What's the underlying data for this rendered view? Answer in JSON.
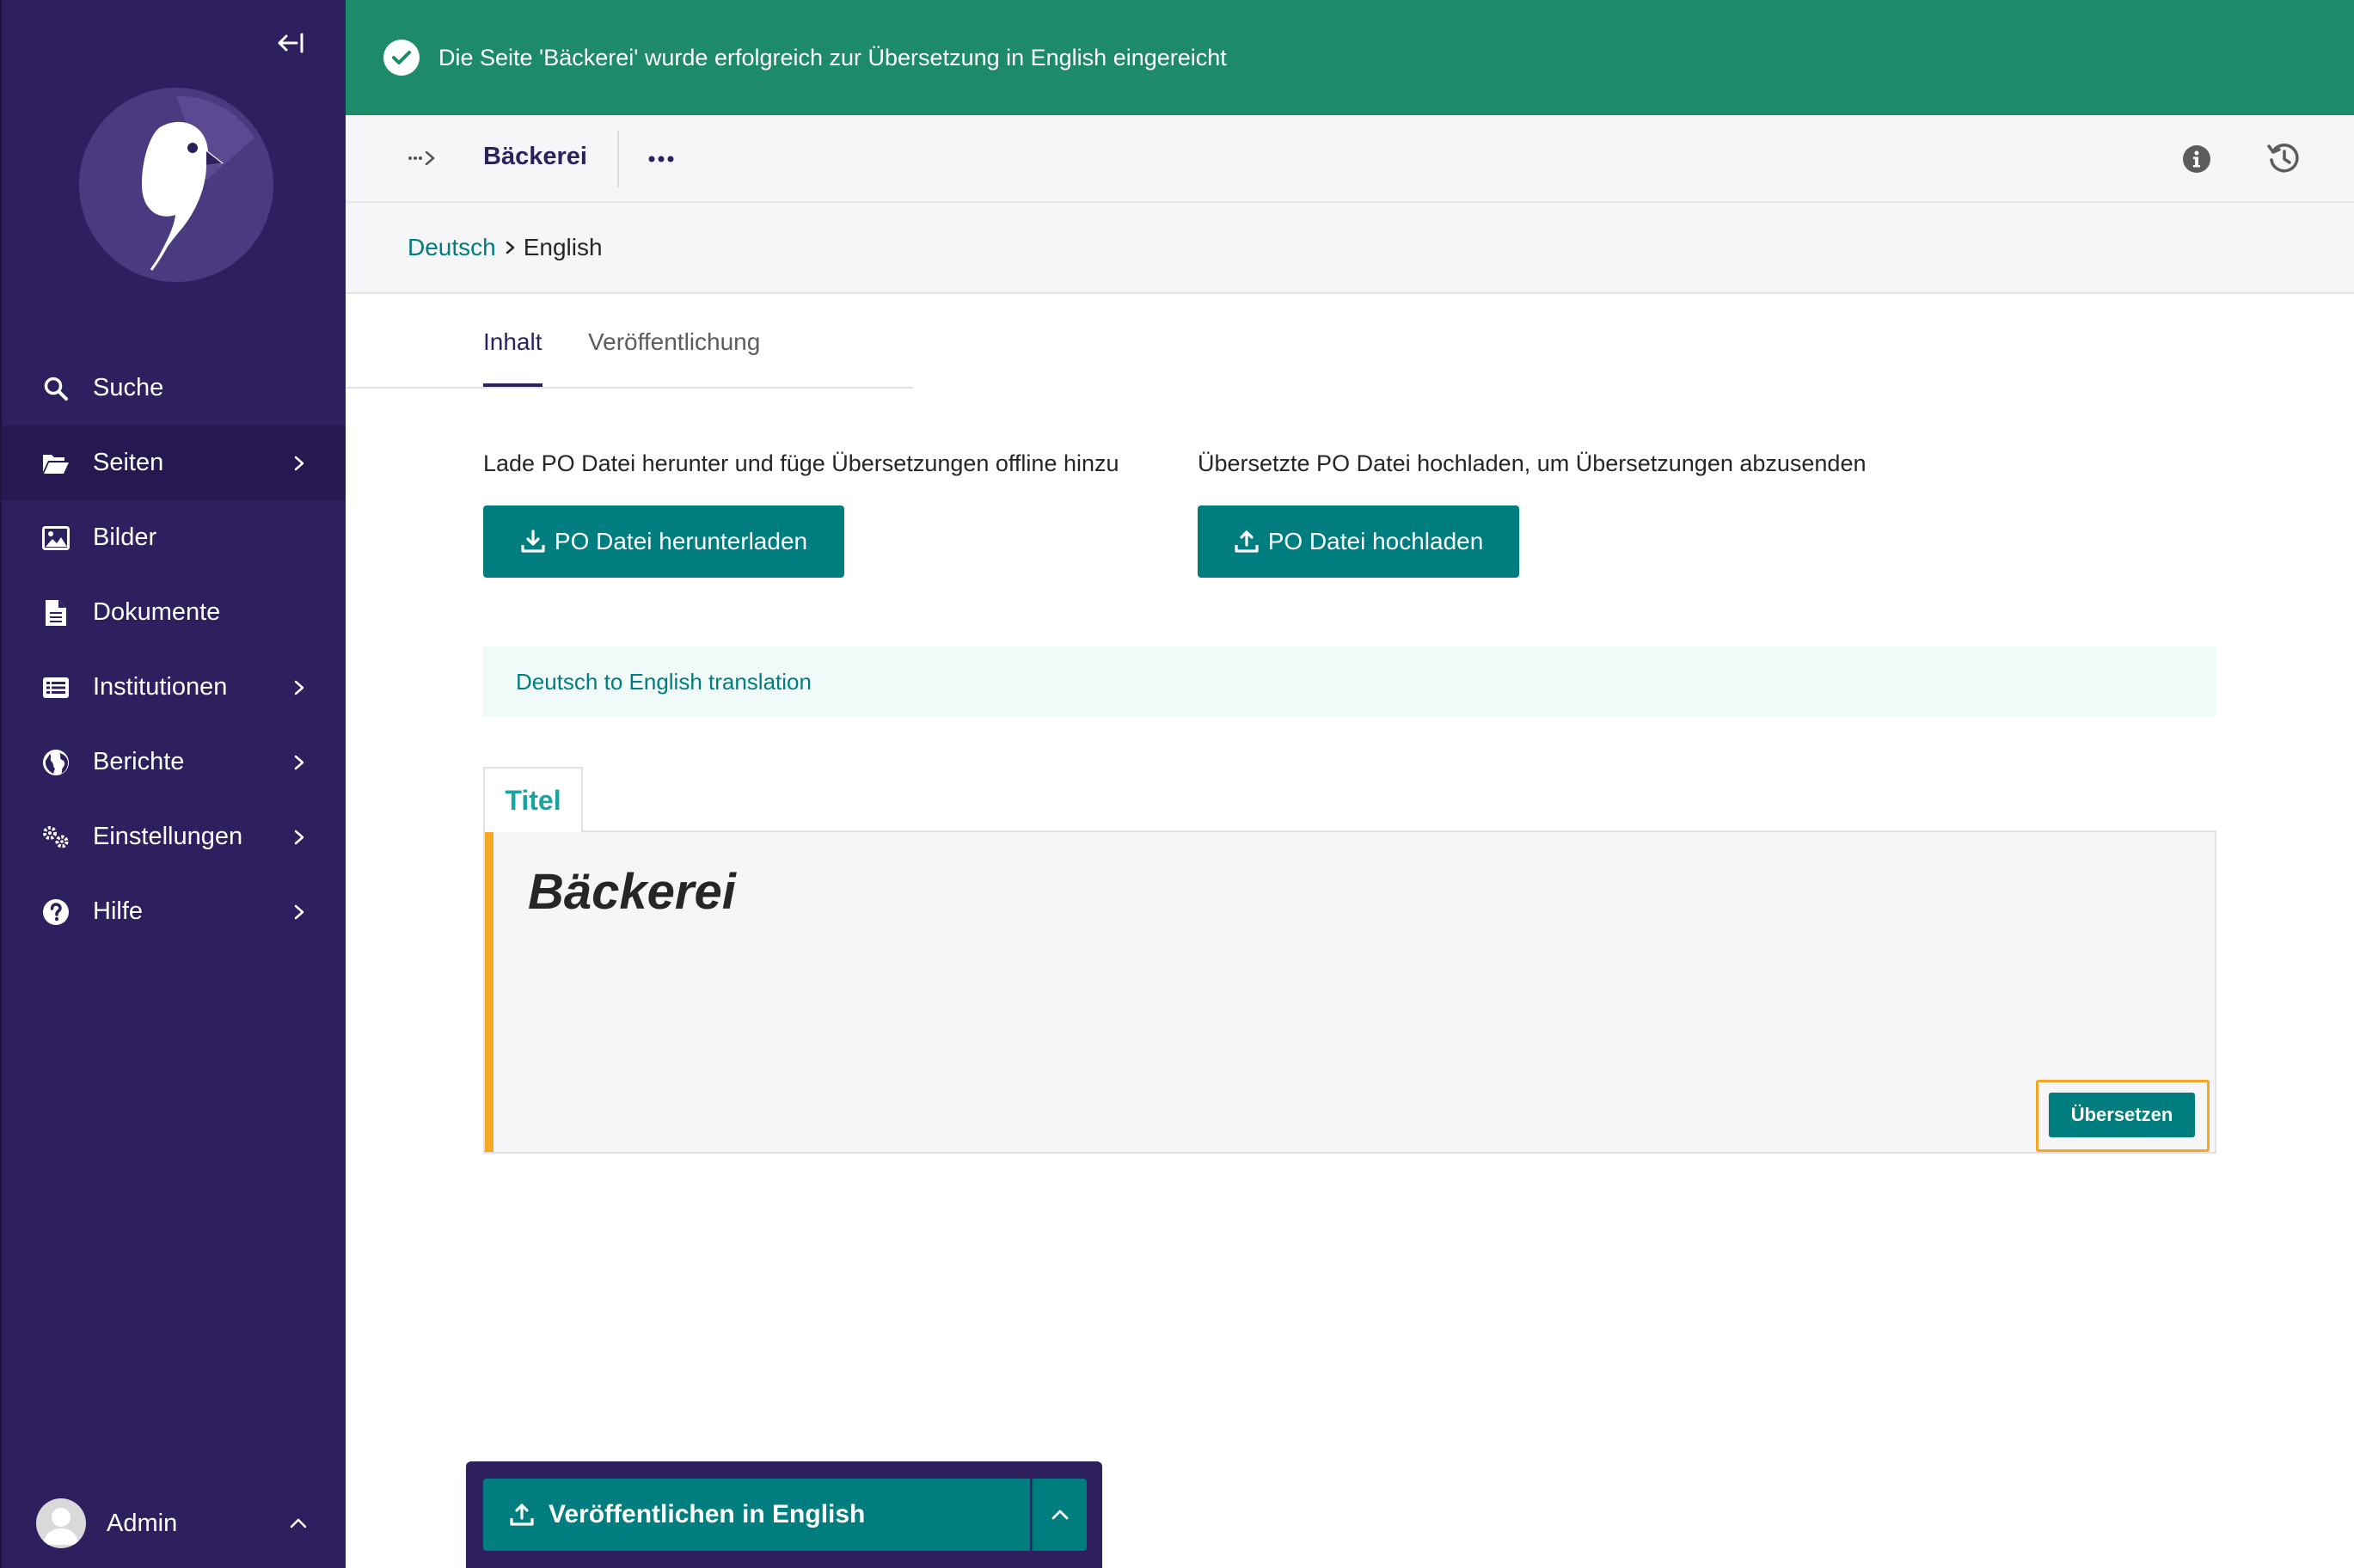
{
  "banner": {
    "message": "Die Seite 'Bäckerei' wurde erfolgreich zur Übersetzung in English eingereicht"
  },
  "sidebar": {
    "items": [
      {
        "label": "Suche",
        "icon": "search-icon",
        "has_children": false
      },
      {
        "label": "Seiten",
        "icon": "folder-open-icon",
        "has_children": true,
        "active": true
      },
      {
        "label": "Bilder",
        "icon": "image-icon",
        "has_children": false
      },
      {
        "label": "Dokumente",
        "icon": "document-icon",
        "has_children": false
      },
      {
        "label": "Institutionen",
        "icon": "list-icon",
        "has_children": true
      },
      {
        "label": "Berichte",
        "icon": "globe-icon",
        "has_children": true
      },
      {
        "label": "Einstellungen",
        "icon": "cogs-icon",
        "has_children": true
      },
      {
        "label": "Hilfe",
        "icon": "help-icon",
        "has_children": true
      }
    ],
    "account": {
      "name": "Admin"
    }
  },
  "header": {
    "title": "Bäckerei"
  },
  "locales": {
    "source": "Deutsch",
    "target": "English"
  },
  "tabs": [
    {
      "label": "Inhalt",
      "active": true
    },
    {
      "label": "Veröffentlichung",
      "active": false
    }
  ],
  "po": {
    "download_text": "Lade PO Datei herunter und füge Übersetzungen offline hinzu",
    "download_button": "PO Datei herunterladen",
    "upload_text": "Übersetzte PO Datei hochladen, um Übersetzungen abzusenden",
    "upload_button": "PO Datei hochladen"
  },
  "translation_info": "Deutsch to English translation",
  "field": {
    "label": "Titel",
    "value": "Bäckerei",
    "translate_button": "Übersetzen"
  },
  "footer": {
    "publish_label": "Veröffentlichen in English"
  },
  "colors": {
    "sidebar": "#2e1f5e",
    "banner": "#1d8b6a",
    "primary": "#007d7e",
    "highlight": "#f5a623"
  }
}
